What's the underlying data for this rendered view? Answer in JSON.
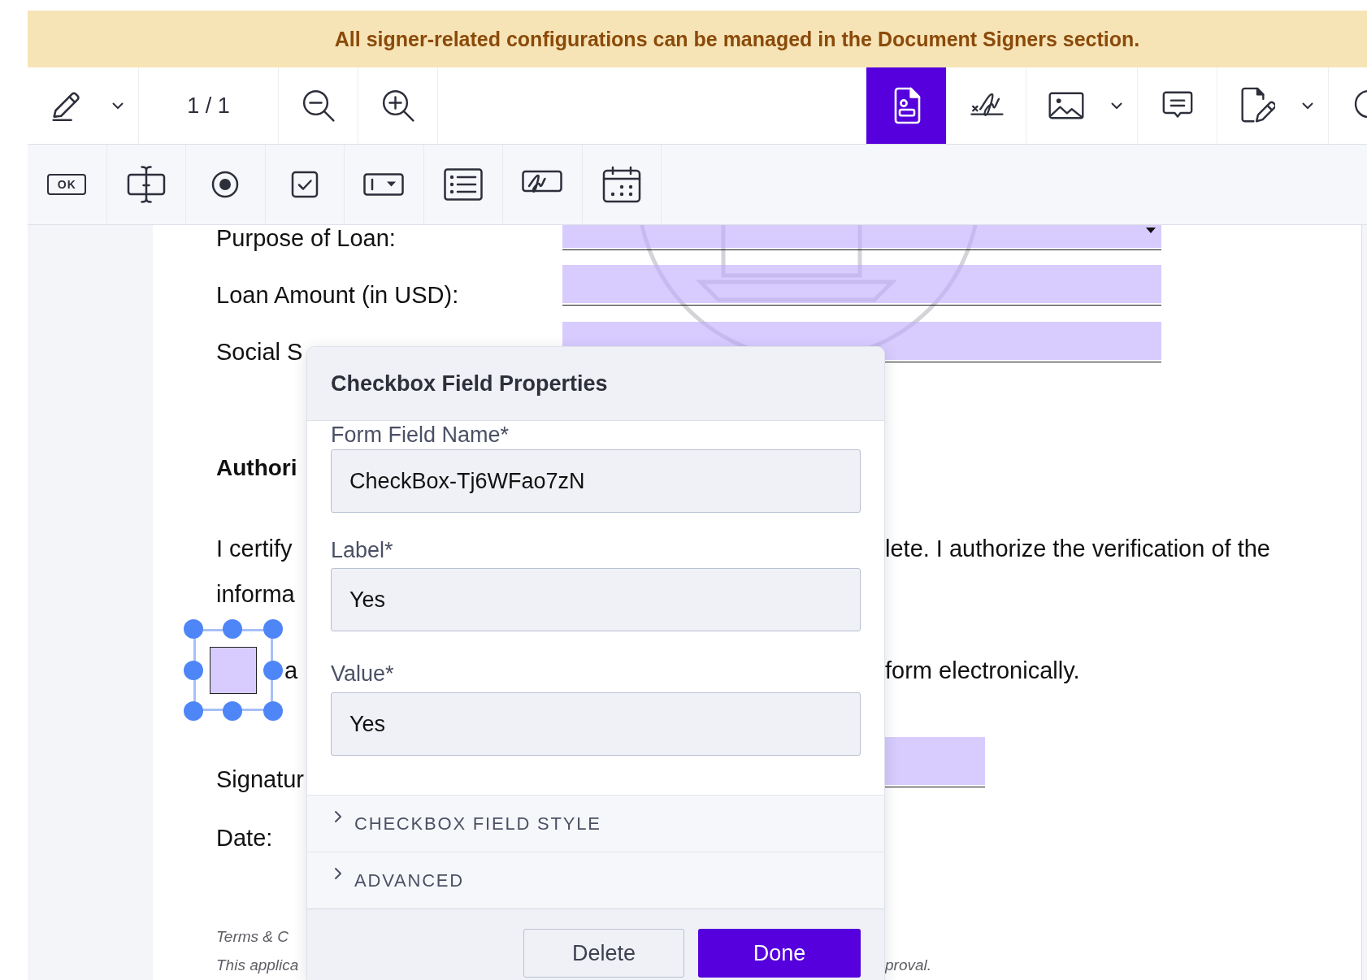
{
  "banner": {
    "text": "All signer-related configurations can be managed in the Document Signers section."
  },
  "main_toolbar": {
    "left_tools": [
      {
        "kind": "pen",
        "dropdown": true,
        "selected": false
      }
    ],
    "page_indicator": "1 / 1",
    "zoom_buttons": [
      {
        "kind": "zoom-out"
      },
      {
        "kind": "zoom-in"
      }
    ],
    "right_tools": [
      {
        "kind": "form-fields",
        "dropdown": false,
        "selected": true
      },
      {
        "kind": "signature",
        "dropdown": false,
        "selected": false
      },
      {
        "kind": "image",
        "dropdown": true,
        "selected": false
      },
      {
        "kind": "comment",
        "dropdown": false,
        "selected": false
      },
      {
        "kind": "edit",
        "dropdown": true,
        "selected": false
      },
      {
        "kind": "search",
        "dropdown": false,
        "selected": false
      }
    ]
  },
  "field_toolbar": {
    "tools": [
      {
        "kind": "button",
        "label": "OK",
        "selected": false
      },
      {
        "kind": "text",
        "selected": false
      },
      {
        "kind": "radio",
        "selected": false
      },
      {
        "kind": "checkbox",
        "selected": false
      },
      {
        "kind": "dropdown",
        "selected": false
      },
      {
        "kind": "list",
        "selected": false
      },
      {
        "kind": "signature",
        "selected": false
      },
      {
        "kind": "date",
        "selected": false
      }
    ]
  },
  "document": {
    "form_rows": [
      {
        "label": "Purpose of Loan:",
        "field": {
          "kind": "dropdown"
        }
      },
      {
        "label": "Loan Amount (in USD):",
        "field": {
          "kind": "text"
        }
      },
      {
        "label": "Social S",
        "field": {
          "kind": "text"
        }
      }
    ],
    "heading": "Authori",
    "paragraph": [
      {
        "left_text": "I certify",
        "right_text": "lete. I authorize the verification of the"
      },
      {
        "left_text": "informa"
      }
    ],
    "consent": {
      "checkbox": {
        "checked": false,
        "selected": true
      },
      "left_text": "a",
      "right_text": "form electronically."
    },
    "signature_row": {
      "label": "Signatur",
      "field": {
        "kind": "text"
      }
    },
    "date_row": {
      "label": "Date:"
    },
    "footnotes": [
      {
        "left_text": "Terms & C"
      },
      {
        "left_text": "This applica",
        "right_text": "proval."
      }
    ]
  },
  "properties_dialog": {
    "title": "Checkbox Field Properties",
    "fields": [
      {
        "label": "Form Field Name*",
        "value": "CheckBox-Tj6WFao7zN"
      },
      {
        "label": "Label*",
        "value": "Yes"
      },
      {
        "label": "Value*",
        "value": "Yes"
      }
    ],
    "sections": [
      {
        "title": "CHECKBOX FIELD STYLE",
        "expanded": false
      },
      {
        "title": "ADVANCED",
        "expanded": false
      }
    ],
    "buttons": [
      {
        "label": "Delete",
        "kind": "secondary"
      },
      {
        "label": "Done",
        "kind": "primary"
      }
    ]
  }
}
